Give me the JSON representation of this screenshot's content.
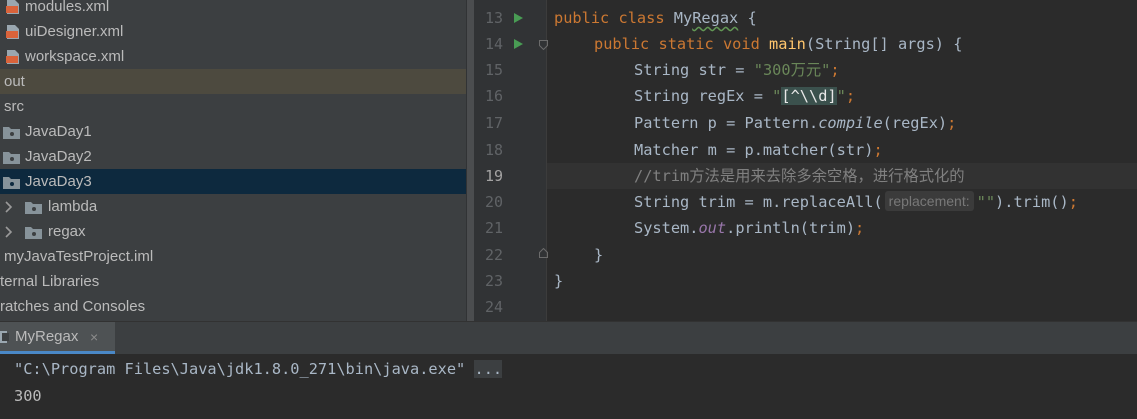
{
  "colors": {
    "accent_tab": "#4a88c7",
    "selection": "#0d293e",
    "keyword": "#cc7832",
    "string": "#6a8759",
    "method": "#ffc66d",
    "comment": "#808080",
    "field": "#9876aa"
  },
  "project_tree": {
    "items": [
      {
        "label": "modules.xml",
        "icon": "xml-file-icon"
      },
      {
        "label": "uiDesigner.xml",
        "icon": "xml-file-icon"
      },
      {
        "label": "workspace.xml",
        "icon": "xml-file-icon"
      },
      {
        "label": "out",
        "icon": ""
      },
      {
        "label": "src",
        "icon": ""
      },
      {
        "label": "JavaDay1",
        "icon": "package-folder-icon"
      },
      {
        "label": "JavaDay2",
        "icon": "package-folder-icon"
      },
      {
        "label": "JavaDay3",
        "icon": "package-folder-icon"
      },
      {
        "label": "lambda",
        "icon": "package-folder-icon"
      },
      {
        "label": "regax",
        "icon": "package-folder-icon"
      },
      {
        "label": "myJavaTestProject.iml",
        "icon": ""
      },
      {
        "label": "ternal Libraries",
        "icon": ""
      },
      {
        "label": "ratches and Consoles",
        "icon": ""
      }
    ]
  },
  "editor": {
    "line_numbers": [
      "13",
      "14",
      "15",
      "16",
      "17",
      "18",
      "19",
      "20",
      "21",
      "22",
      "23",
      "24"
    ],
    "current_line": "19",
    "lines": {
      "l13": {
        "kw1": "public",
        "kw2": "class",
        "name": "MyRegax",
        "brace": " {"
      },
      "l14": {
        "kw1": "public",
        "kw2": "static",
        "kw3": "void",
        "method": "main",
        "params": "(String[] args) {"
      },
      "l15": {
        "pre": "String str = ",
        "str": "\"300万元\"",
        "end": ";"
      },
      "l16": {
        "pre": "String regEx = ",
        "q1": "\"",
        "regex": "[^\\\\d]",
        "q2": "\"",
        "end": ";"
      },
      "l17": {
        "pre": "Pattern p = Pattern.",
        "ital": "compile",
        "post": "(regEx)",
        "end": ";"
      },
      "l18": {
        "pre": "Matcher m = p.matcher(str)",
        "end": ";"
      },
      "l19": {
        "comment": "//trim方法是用来去除多余空格，进行格式化的"
      },
      "l20": {
        "pre": "String trim = m.replaceAll(",
        "hint": "replacement:",
        "str": "\"\"",
        "post": ").trim()",
        "end": ";"
      },
      "l21": {
        "pre": "System.",
        "field": "out",
        "post": ".println(trim)",
        "end": ";"
      },
      "l22": {
        "text": "}"
      },
      "l23": {
        "text": "}"
      }
    }
  },
  "run_panel": {
    "tab_label": "MyRegax",
    "close_glyph": "×",
    "command": "\"C:\\Program Files\\Java\\jdk1.8.0_271\\bin\\java.exe\" ",
    "ellipsis": "...",
    "output": "300"
  }
}
